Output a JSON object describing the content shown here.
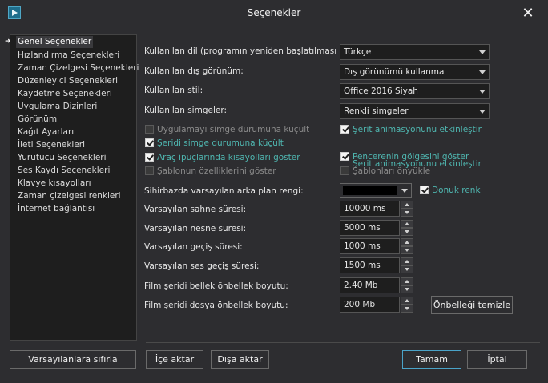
{
  "window": {
    "title": "Seçenekler"
  },
  "sidebar": {
    "items": [
      "Genel Seçenekler",
      "Hızlandırma Seçenekleri",
      "Zaman Çizelgesi Seçenekleri",
      "Düzenleyici Seçenekleri",
      "Kaydetme Seçenekleri",
      "Uygulama Dizinleri",
      "Görünüm",
      "Kağıt Ayarları",
      "İleti Seçenekleri",
      "Yürütücü Seçenekleri",
      "Ses Kaydı Seçenekleri",
      "Klavye kısayolları",
      "Zaman çizelgesi renkleri",
      "İnternet bağlantısı"
    ]
  },
  "general": {
    "language_label": "Kullanılan dil (programın yeniden başlatılması gerekir)",
    "language_value": "Türkçe",
    "appearance_label": "Kullanılan dış görünüm:",
    "appearance_value": "Dış görünümü kullanma",
    "style_label": "Kullanılan stil:",
    "style_value": "Office 2016 Siyah",
    "icons_label": "Kullanılan simgeler:",
    "icons_value": "Renkli simgeler",
    "checkboxes": {
      "minimize_tray": "Uygulamayı simge durumuna küçült",
      "ribbon_animation": "Şerit animasyonunu etkinleştir",
      "minimize_ribbon": "Şeridi simge durumuna küçült",
      "ribbon_animation_overlap": "Şerit animasyonunu etkinleştir",
      "tooltips_shortcuts": "Araç ipuçlarında kısayolları göster",
      "window_shadow": "Pencerenin gölgesini göster",
      "template_props": "Şablonun özelliklerini göster",
      "template_preload": "Şablonları önyükle"
    },
    "wizard_bg_label": "Sihirbazda varsayılan arka plan rengi:",
    "frozen_color": "Donuk renk",
    "scene_duration_label": "Varsayılan sahne süresi:",
    "scene_duration": "10000 ms",
    "object_duration_label": "Varsayılan nesne süresi:",
    "object_duration": "5000 ms",
    "transition_duration_label": "Varsayılan geçiş süresi:",
    "transition_duration": "1000 ms",
    "audio_transition_label": "Varsayılan ses geçiş süresi:",
    "audio_transition": "1500 ms",
    "film_memory_label": "Film şeridi bellek önbellek boyutu:",
    "film_memory": "2.40 Mb",
    "film_file_label": "Film şeridi dosya önbellek boyutu:",
    "film_file": "200 Mb",
    "clear_cache": "Önbelleği temizle"
  },
  "footer": {
    "reset": "Varsayılanlara sıfırla",
    "import": "İçe aktar",
    "export": "Dışa aktar",
    "ok": "Tamam",
    "cancel": "İptal"
  },
  "colors": {
    "accent_teal": "#4fb6b0",
    "background": "#2d2d30",
    "field": "#1e1e1e"
  }
}
